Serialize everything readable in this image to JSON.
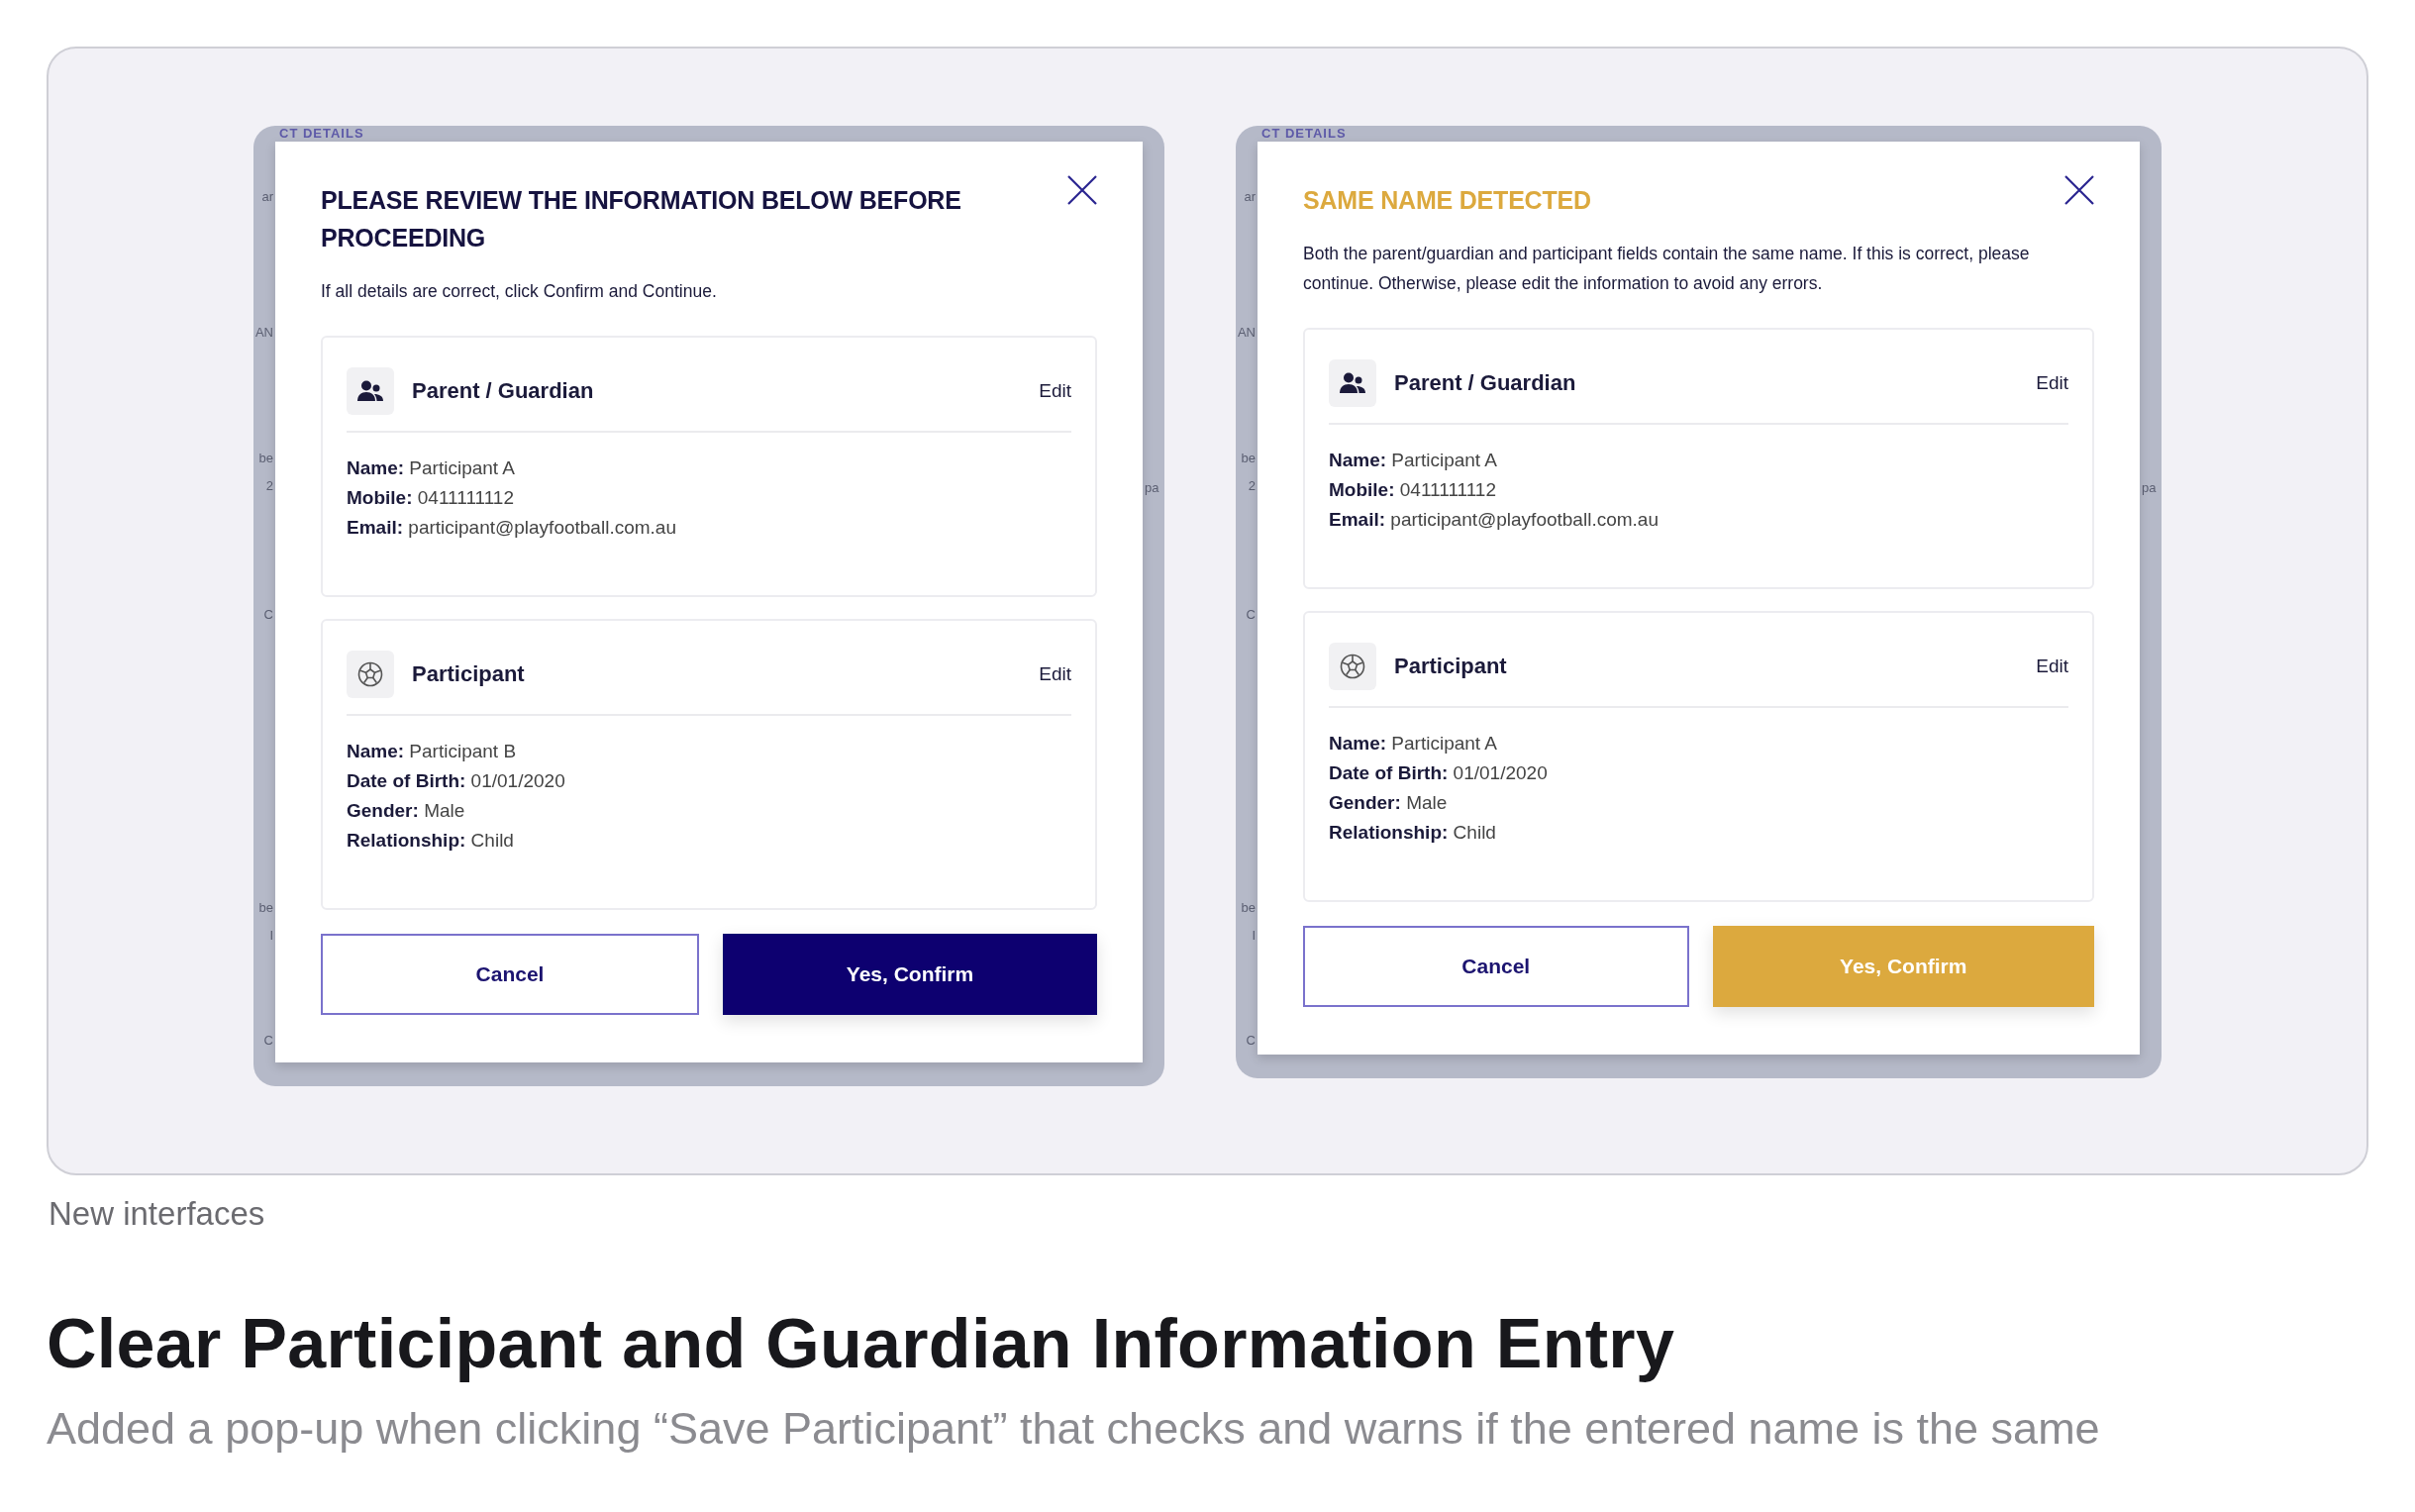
{
  "screens": [
    {
      "backdrop": {
        "heading": "CT DETAILS",
        "left_fragments": [
          "ar",
          "AN",
          "be",
          "2",
          "C",
          "be",
          "I",
          "C"
        ],
        "right_fragments": [
          "pa"
        ]
      },
      "modal": {
        "kind": "review",
        "title": "PLEASE REVIEW THE INFORMATION BELOW BEFORE PROCEEDING",
        "message": "If all details are correct, click Confirm and Continue.",
        "sections": [
          {
            "kind": "guardian",
            "title": "Parent / Guardian",
            "edit": "Edit",
            "fields": [
              {
                "label": "Name:",
                "value": "Participant A"
              },
              {
                "label": "Mobile:",
                "value": "0411111112"
              },
              {
                "label": "Email:",
                "value": "participant@playfootball.com.au"
              }
            ]
          },
          {
            "kind": "participant",
            "title": "Participant",
            "edit": "Edit",
            "fields": [
              {
                "label": "Name:",
                "value": "Participant B"
              },
              {
                "label": "Date of Birth:",
                "value": "01/01/2020"
              },
              {
                "label": "Gender:",
                "value": "Male"
              },
              {
                "label": "Relationship:",
                "value": "Child"
              }
            ]
          }
        ],
        "buttons": [
          {
            "kind": "secondary",
            "label": "Cancel"
          },
          {
            "kind": "primary",
            "label": "Yes, Confirm"
          }
        ]
      }
    },
    {
      "backdrop": {
        "heading": "CT DETAILS",
        "left_fragments": [
          "ar",
          "AN",
          "be",
          "2",
          "C",
          "be",
          "I",
          "C"
        ],
        "right_fragments": [
          "pa"
        ]
      },
      "modal": {
        "kind": "warning",
        "title": "SAME NAME DETECTED",
        "message": "Both the parent/guardian and participant fields contain the same name. If this is correct, please continue. Otherwise, please edit the information to avoid any errors.",
        "sections": [
          {
            "kind": "guardian",
            "title": "Parent / Guardian",
            "edit": "Edit",
            "fields": [
              {
                "label": "Name:",
                "value": "Participant A"
              },
              {
                "label": "Mobile:",
                "value": "0411111112"
              },
              {
                "label": "Email:",
                "value": "participant@playfootball.com.au"
              }
            ]
          },
          {
            "kind": "participant",
            "title": "Participant",
            "edit": "Edit",
            "fields": [
              {
                "label": "Name:",
                "value": "Participant A"
              },
              {
                "label": "Date of Birth:",
                "value": "01/01/2020"
              },
              {
                "label": "Gender:",
                "value": "Male"
              },
              {
                "label": "Relationship:",
                "value": "Child"
              }
            ]
          }
        ],
        "buttons": [
          {
            "kind": "secondary",
            "label": "Cancel"
          },
          {
            "kind": "primary",
            "label": "Yes, Confirm"
          }
        ]
      }
    }
  ],
  "caption": "New interfaces",
  "heading": "Clear Participant and Guardian Information Entry",
  "description": "Added a pop-up when clicking “Save Participant” that checks and warns if the entered name is the same"
}
